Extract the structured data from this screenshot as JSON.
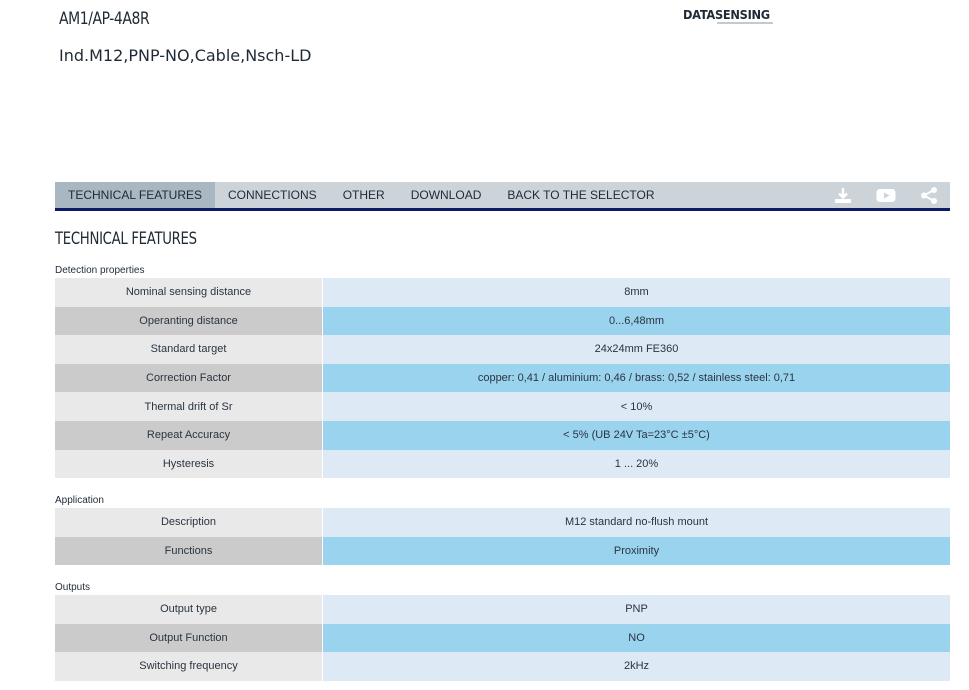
{
  "header": {
    "product_code": "AM1/AP-4A8R",
    "product_description": "Ind.M12,PNP-NO,Cable,Nsch-LD",
    "logo_text": "DATASENSING"
  },
  "tabs": [
    {
      "label": "TECHNICAL FEATURES",
      "active": true
    },
    {
      "label": "CONNECTIONS",
      "active": false
    },
    {
      "label": "OTHER",
      "active": false
    },
    {
      "label": "DOWNLOAD",
      "active": false
    },
    {
      "label": "BACK TO THE SELECTOR",
      "active": false
    }
  ],
  "toolbar_icons": [
    "download-icon",
    "video-icon",
    "share-icon"
  ],
  "section_title": "TECHNICAL FEATURES",
  "groups": [
    {
      "title": "Detection properties",
      "rows": [
        {
          "label": "Nominal sensing distance",
          "value": "8mm"
        },
        {
          "label": "Operanting distance",
          "value": "0...6,48mm"
        },
        {
          "label": "Standard target",
          "value": "24x24mm FE360"
        },
        {
          "label": "Correction Factor",
          "value": "copper: 0,41 / aluminium: 0,46 / brass: 0,52 / stainless steel: 0,71"
        },
        {
          "label": "Thermal drift of Sr",
          "value": "< 10%"
        },
        {
          "label": "Repeat Accuracy",
          "value": "< 5% (UB 24V Ta=23°C ±5°C)"
        },
        {
          "label": "Hysteresis",
          "value": "1 ... 20%"
        }
      ]
    },
    {
      "title": "Application",
      "rows": [
        {
          "label": "Description",
          "value": "M12 standard no-flush mount"
        },
        {
          "label": "Functions",
          "value": "Proximity"
        }
      ]
    },
    {
      "title": "Outputs",
      "rows": [
        {
          "label": "Output type",
          "value": "PNP"
        },
        {
          "label": "Output Function",
          "value": "NO"
        },
        {
          "label": "Switching frequency",
          "value": "2kHz"
        }
      ]
    }
  ],
  "colors": {
    "tabbar_bg": "#ccd4da",
    "tab_active_bg": "#a9b7c2",
    "tabbar_underline": "#0e1a63",
    "label_light": "#e9e9e9",
    "label_dark": "#cbcbcb",
    "value_light": "#dde9f5",
    "value_dark": "#9ad3ee"
  }
}
